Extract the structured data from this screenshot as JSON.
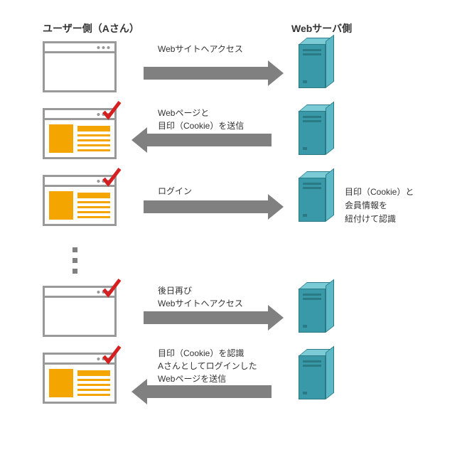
{
  "headers": {
    "user": "ユーザー側（Aさん）",
    "server": "Webサーバ側"
  },
  "rows": [
    {
      "label": "Webサイトへアクセス"
    },
    {
      "label": "Webページと\n目印（Cookie）を送信"
    },
    {
      "label": "ログイン",
      "side": "目印（Cookie）と\n会員情報を\n紐付けて認識"
    },
    {
      "label": "後日再び\nWebサイトへアクセス"
    },
    {
      "label": "目印（Cookie）を認識\nAさんとしてログインした\nWebページを送信"
    }
  ]
}
